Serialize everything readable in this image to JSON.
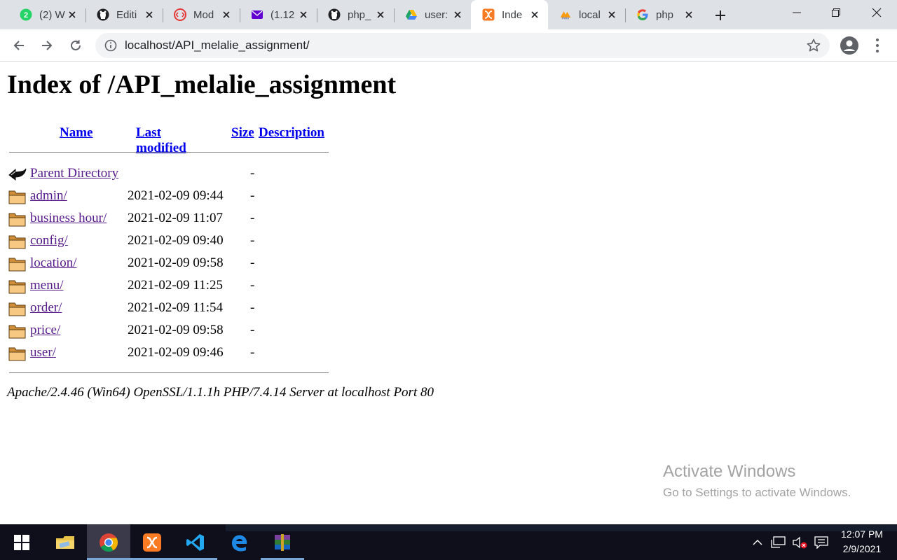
{
  "browser": {
    "tabs": [
      {
        "title": "(2) W",
        "icon": "whatsapp-icon",
        "color": "#25d366",
        "badge": "2"
      },
      {
        "title": "Editi",
        "icon": "github-icon",
        "color": "#202124"
      },
      {
        "title": "Mod",
        "icon": "code-icon",
        "color": "#e53935"
      },
      {
        "title": "(1.12",
        "icon": "mail-icon",
        "color": "#6001d2"
      },
      {
        "title": "php_",
        "icon": "github-icon",
        "color": "#202124"
      },
      {
        "title": "user:",
        "icon": "google-drive-icon",
        "color": "#1fa463"
      },
      {
        "title": "Inde",
        "icon": "xampp-icon",
        "color": "#fb7a24",
        "active": true
      },
      {
        "title": "local",
        "icon": "phpmyadmin-icon",
        "color": "#f89c0e"
      },
      {
        "title": "php",
        "icon": "google-icon",
        "color": "#4285f4"
      }
    ],
    "url": "localhost/API_melalie_assignment/"
  },
  "page": {
    "title": "Index of /API_melalie_assignment",
    "columns": {
      "name": "Name",
      "last_modified": "Last modified",
      "size": "Size",
      "description": "Description"
    },
    "parent": {
      "name": "Parent Directory",
      "size": "-"
    },
    "entries": [
      {
        "name": "admin/",
        "modified": "2021-02-09 09:44",
        "size": "-"
      },
      {
        "name": "business hour/",
        "modified": "2021-02-09 11:07",
        "size": "-"
      },
      {
        "name": "config/",
        "modified": "2021-02-09 09:40",
        "size": "-"
      },
      {
        "name": "location/",
        "modified": "2021-02-09 09:58",
        "size": "-"
      },
      {
        "name": "menu/",
        "modified": "2021-02-09 11:25",
        "size": "-"
      },
      {
        "name": "order/",
        "modified": "2021-02-09 11:54",
        "size": "-"
      },
      {
        "name": "price/",
        "modified": "2021-02-09 09:58",
        "size": "-"
      },
      {
        "name": "user/",
        "modified": "2021-02-09 09:46",
        "size": "-"
      }
    ],
    "address": "Apache/2.4.46 (Win64) OpenSSL/1.1.1h PHP/7.4.14 Server at localhost Port 80"
  },
  "watermark": {
    "title": "Activate Windows",
    "subtitle": "Go to Settings to activate Windows."
  },
  "taskbar": {
    "apps": [
      "start-button",
      "file-explorer",
      "chrome",
      "xampp",
      "vscode",
      "edge",
      "winrar"
    ],
    "time": "12:07 PM",
    "date": "2/9/2021"
  }
}
